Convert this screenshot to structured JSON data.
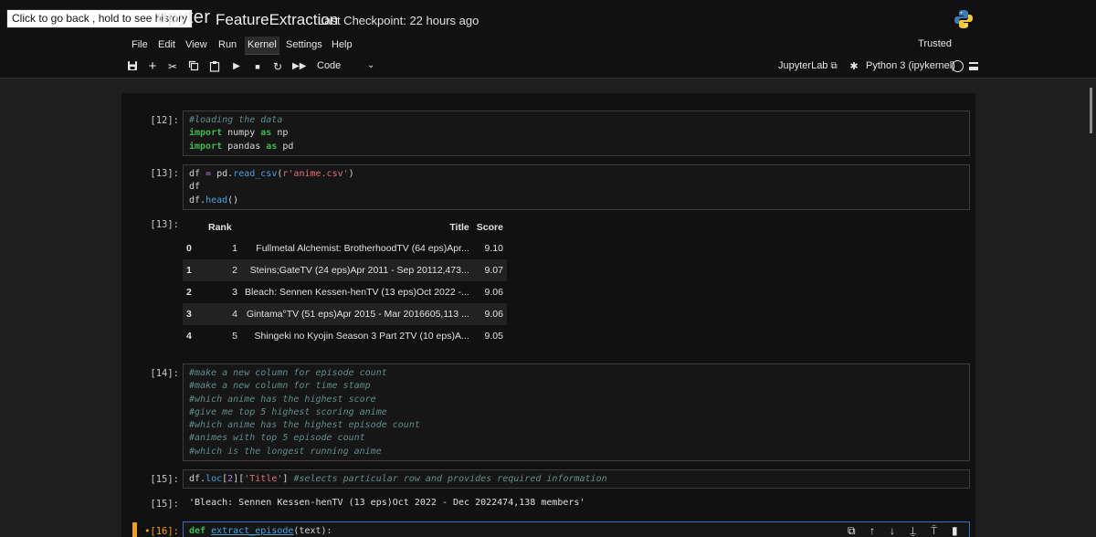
{
  "header": {
    "back_tooltip": "Click to go back , hold to see history",
    "logo_text": "upyter",
    "notebook_title": "FeatureExtraction",
    "checkpoint": "Last Checkpoint: 22 hours ago"
  },
  "menubar": {
    "items": [
      "File",
      "Edit",
      "View",
      "Run",
      "Kernel",
      "Settings",
      "Help"
    ],
    "active": "Kernel",
    "trusted_label": "Trusted"
  },
  "toolbar": {
    "buttons": [
      "save-icon",
      "add-cell-icon",
      "cut-icon",
      "copy-icon",
      "paste-icon",
      "run-icon",
      "stop-icon",
      "restart-icon",
      "fast-forward-icon"
    ],
    "cell_type": "Code",
    "jupyterlab_label": "JupyterLab",
    "kernel_name": "Python 3 (ipykernel)"
  },
  "cells": {
    "c12": {
      "prompt": "[12]:",
      "lines": [
        "#loading the data",
        "import numpy as np",
        "import pandas as pd"
      ]
    },
    "c13": {
      "prompt": "[13]:",
      "lines": [
        "df = pd.read_csv(r'anime.csv')",
        "df",
        "df.head()"
      ],
      "out_prompt": "[13]:"
    },
    "c14": {
      "prompt": "[14]:",
      "lines": [
        "#make a new column for episode count",
        "#make a new column for time stamp",
        "#which anime has the highest score",
        "#give me top 5 highest scoring anime",
        "#which anime has the highest episode count",
        "#animes with top 5 episode count",
        "#which is the longest running anime"
      ]
    },
    "c15": {
      "prompt": "[15]:",
      "code": "df.loc[2]['Title'] #selects particular row and provides required information",
      "out_prompt": "[15]:",
      "output": "'Bleach: Sennen Kessen-henTV (13 eps)Oct 2022 - Dec 2022474,138 members'"
    },
    "c16": {
      "prompt": "[16]:",
      "code": "def extract_episode(text):"
    }
  },
  "dataframe": {
    "columns": [
      "",
      "Rank",
      "Title",
      "Score"
    ],
    "rows": [
      {
        "index": "0",
        "rank": "1",
        "title": "Fullmetal Alchemist: BrotherhoodTV (64 eps)Apr...",
        "score": "9.10"
      },
      {
        "index": "1",
        "rank": "2",
        "title": "Steins;GateTV (24 eps)Apr 2011 - Sep 20112,473...",
        "score": "9.07"
      },
      {
        "index": "2",
        "rank": "3",
        "title": "Bleach: Sennen Kessen-henTV (13 eps)Oct 2022 -...",
        "score": "9.06"
      },
      {
        "index": "3",
        "rank": "4",
        "title": "Gintama°TV (51 eps)Apr 2015 - Mar 2016605,113 ...",
        "score": "9.06"
      },
      {
        "index": "4",
        "rank": "5",
        "title": "Shingeki no Kyojin Season 3 Part 2TV (10 eps)A...",
        "score": "9.05"
      }
    ]
  },
  "colors": {
    "background": "#111111",
    "keyword": "#3fb950",
    "comment": "#5e8c8c",
    "function": "#4aa3df",
    "string": "#e06c75",
    "active_accent": "#f0a020"
  }
}
